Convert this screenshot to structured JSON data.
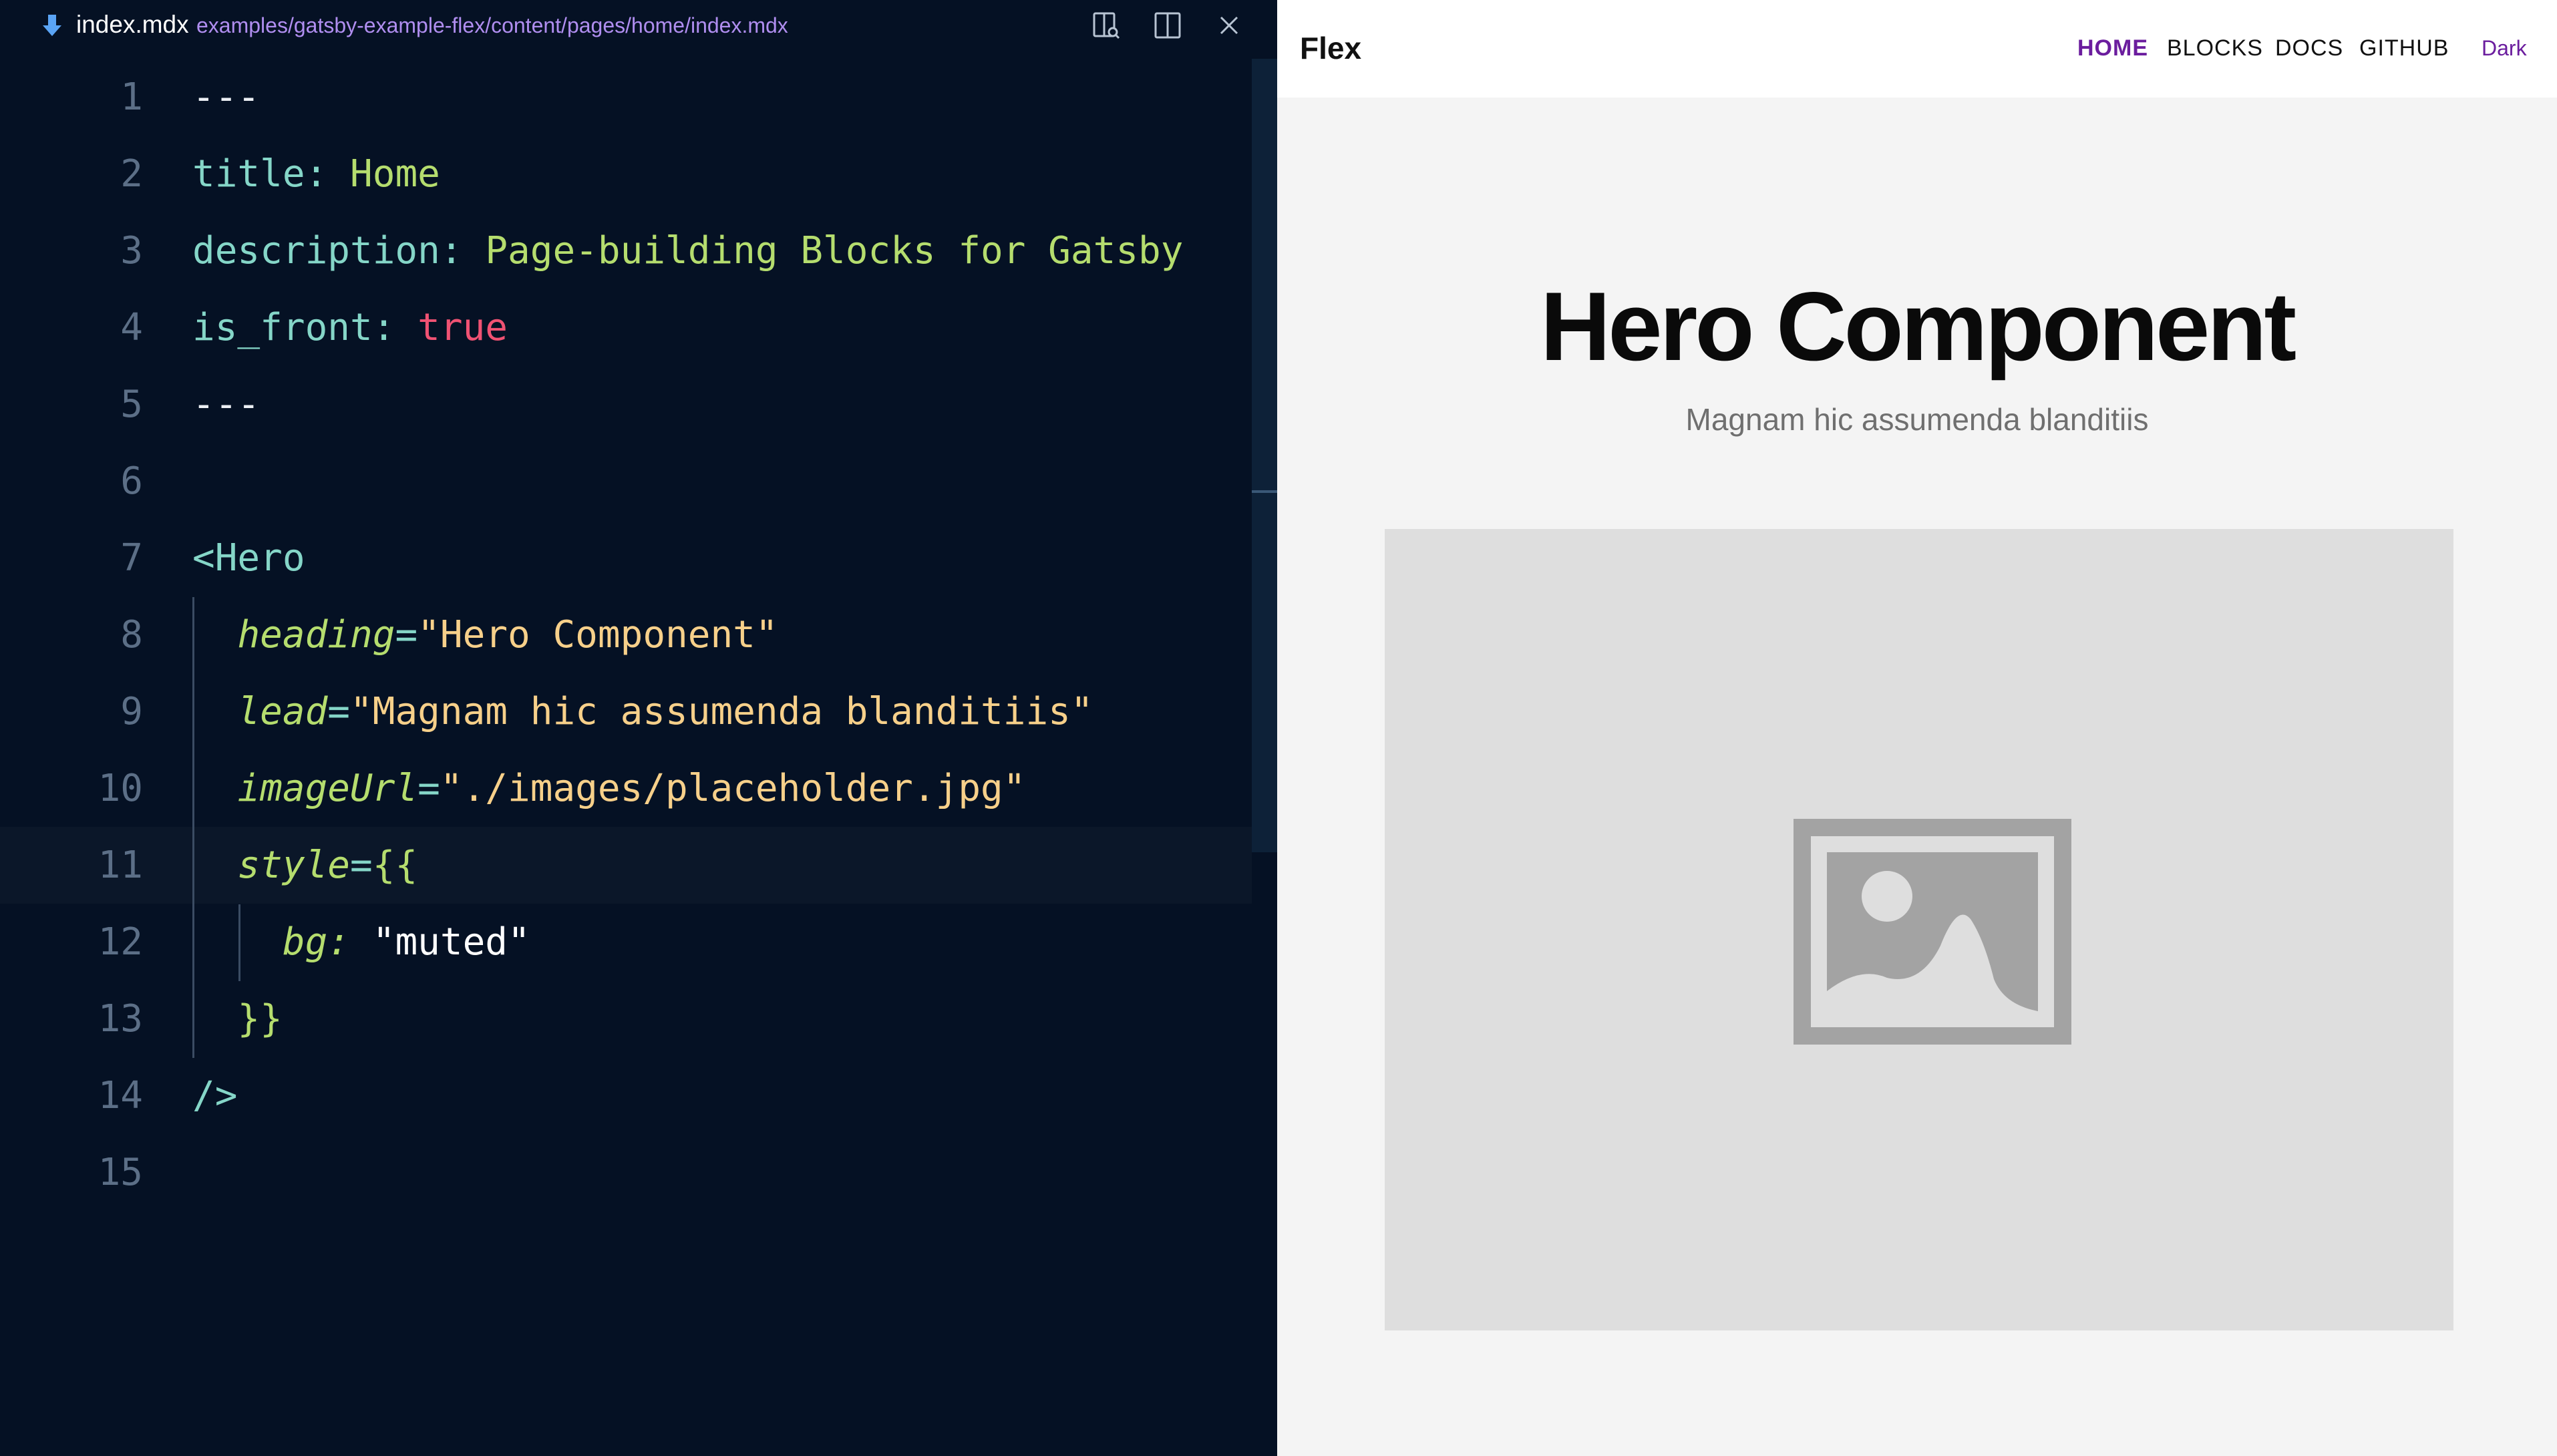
{
  "editor": {
    "tab": {
      "filename": "index.mdx",
      "path": "examples/gatsby-example-flex/content/pages/home/index.mdx"
    },
    "lines": [
      {
        "number": "1",
        "segments": [
          {
            "cls": "t-dash",
            "text": "---"
          }
        ]
      },
      {
        "number": "2",
        "segments": [
          {
            "cls": "t-key",
            "text": "title"
          },
          {
            "cls": "t-punc",
            "text": ": "
          },
          {
            "cls": "t-val",
            "text": "Home"
          }
        ]
      },
      {
        "number": "3",
        "segments": [
          {
            "cls": "t-key",
            "text": "description"
          },
          {
            "cls": "t-punc",
            "text": ": "
          },
          {
            "cls": "t-val",
            "text": "Page-building Blocks for Gatsby"
          }
        ]
      },
      {
        "number": "4",
        "segments": [
          {
            "cls": "t-key",
            "text": "is_front"
          },
          {
            "cls": "t-punc",
            "text": ": "
          },
          {
            "cls": "t-bool",
            "text": "true"
          }
        ]
      },
      {
        "number": "5",
        "segments": [
          {
            "cls": "t-dash",
            "text": "---"
          }
        ]
      },
      {
        "number": "6",
        "segments": []
      },
      {
        "number": "7",
        "segments": [
          {
            "cls": "t-tag",
            "text": "<Hero"
          }
        ]
      },
      {
        "number": "8",
        "segments": [
          {
            "cls": "t-plain",
            "text": "  "
          },
          {
            "cls": "t-attr",
            "text": "heading"
          },
          {
            "cls": "t-eq",
            "text": "="
          },
          {
            "cls": "t-str",
            "text": "\"Hero Component\""
          }
        ]
      },
      {
        "number": "9",
        "segments": [
          {
            "cls": "t-plain",
            "text": "  "
          },
          {
            "cls": "t-attr",
            "text": "lead"
          },
          {
            "cls": "t-eq",
            "text": "="
          },
          {
            "cls": "t-str",
            "text": "\"Magnam hic assumenda blanditiis\""
          }
        ]
      },
      {
        "number": "10",
        "segments": [
          {
            "cls": "t-plain",
            "text": "  "
          },
          {
            "cls": "t-attr",
            "text": "imageUrl"
          },
          {
            "cls": "t-eq",
            "text": "="
          },
          {
            "cls": "t-str",
            "text": "\"./images/placeholder.jpg\""
          }
        ]
      },
      {
        "number": "11",
        "segments": [
          {
            "cls": "t-plain",
            "text": "  "
          },
          {
            "cls": "t-attr",
            "text": "style"
          },
          {
            "cls": "t-eq",
            "text": "="
          },
          {
            "cls": "t-brace",
            "text": "{{"
          }
        ]
      },
      {
        "number": "12",
        "segments": [
          {
            "cls": "t-plain",
            "text": "    "
          },
          {
            "cls": "t-attr",
            "text": "bg:"
          },
          {
            "cls": "t-plain",
            "text": " \"muted\""
          }
        ]
      },
      {
        "number": "13",
        "segments": [
          {
            "cls": "t-plain",
            "text": "  "
          },
          {
            "cls": "t-brace",
            "text": "}}"
          }
        ]
      },
      {
        "number": "14",
        "segments": [
          {
            "cls": "t-tag",
            "text": "/>"
          }
        ]
      },
      {
        "number": "15",
        "segments": []
      }
    ],
    "active_line_index": 10
  },
  "preview": {
    "brand": "Flex",
    "nav": [
      {
        "label": "HOME",
        "active": true
      },
      {
        "label": "BLOCKS",
        "active": false
      },
      {
        "label": "DOCS",
        "active": false
      },
      {
        "label": "GITHUB",
        "active": false
      }
    ],
    "theme_toggle": "Dark",
    "hero": {
      "heading": "Hero Component",
      "lead": "Magnam hic assumenda blanditiis",
      "image_icon": "image-placeholder-icon"
    }
  },
  "colors": {
    "editor_bg": "#051124",
    "accent_purple": "#6b1d9e",
    "preview_bg": "#f4f4f4"
  }
}
